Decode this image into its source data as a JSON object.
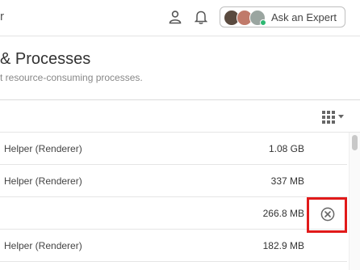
{
  "topbar": {
    "partial_title": "r",
    "expert_button_label": "Ask an Expert"
  },
  "page": {
    "title": "& Processes",
    "subtitle": "t resource-consuming processes."
  },
  "processes": [
    {
      "name": "Helper (Renderer)",
      "memory": "1.08 GB"
    },
    {
      "name": "Helper (Renderer)",
      "memory": "337 MB"
    },
    {
      "name": "",
      "memory": "266.8 MB"
    },
    {
      "name": "Helper (Renderer)",
      "memory": "182.9 MB"
    }
  ],
  "icons": {
    "user": "user-icon",
    "bell": "bell-icon",
    "columns": "grid-icon",
    "kill": "close-circle-icon"
  },
  "colors": {
    "highlight": "#e11a1a"
  }
}
